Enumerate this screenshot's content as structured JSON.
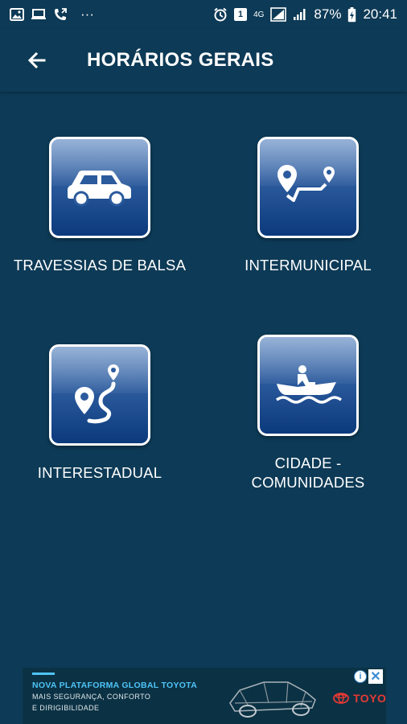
{
  "status_bar": {
    "battery": "87%",
    "time": "20:41",
    "notification_count": "1",
    "network": "4G",
    "more": "···"
  },
  "header": {
    "title": "HORÁRIOS GERAIS",
    "back_icon": "arrow-left-icon"
  },
  "tiles": [
    {
      "label": "TRAVESSIAS DE BALSA",
      "icon": "car-icon"
    },
    {
      "label": "INTERMUNICIPAL",
      "icon": "route-icon"
    },
    {
      "label": "INTERESTADUAL",
      "icon": "winding-route-icon"
    },
    {
      "label": "CIDADE -\nCOMUNIDADES",
      "icon": "boat-icon"
    }
  ],
  "ad": {
    "headline": "NOVA PLATAFORMA GLOBAL TOYOTA",
    "line1": "MAIS SEGURANÇA, CONFORTO",
    "line2": "E DIRIGIBILIDADE",
    "brand": "TOYOTA",
    "info": "i",
    "close": "✕"
  },
  "colors": {
    "background": "#0d3a56",
    "tile_gradient_top": "#6f95c8",
    "tile_gradient_bottom": "#0b3a7c",
    "ad_accent": "#4fc3f7",
    "brand_red": "#e53935"
  }
}
